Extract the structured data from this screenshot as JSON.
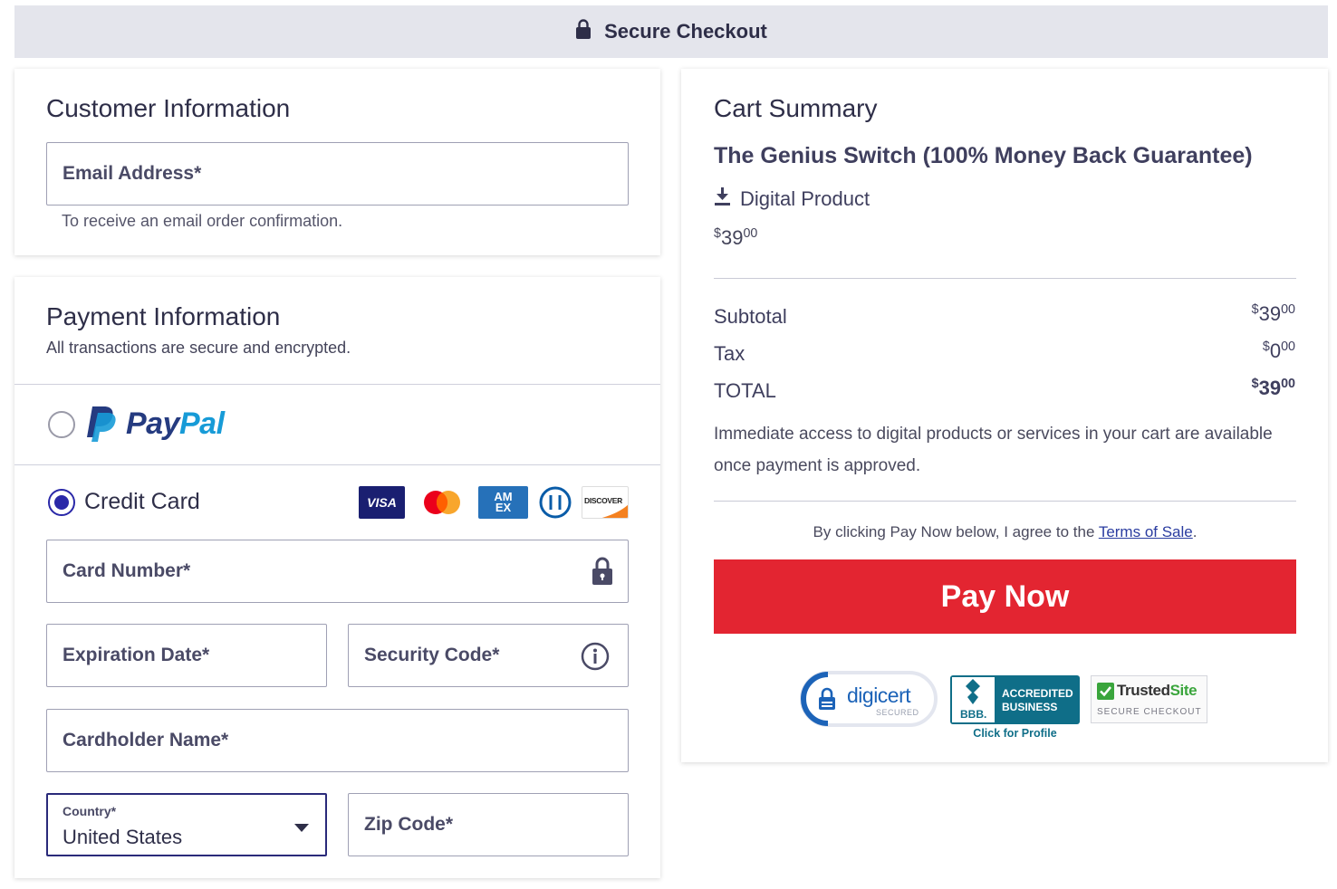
{
  "header": {
    "title": "Secure Checkout"
  },
  "customer": {
    "title": "Customer Information",
    "email_placeholder": "Email Address*",
    "email_helper": "To receive an email order confirmation."
  },
  "payment": {
    "title": "Payment Information",
    "subtitle": "All transactions are secure and encrypted.",
    "paypal_label_pay": "Pay",
    "paypal_label_pal": "Pal",
    "credit_card_label": "Credit Card",
    "card_logos": {
      "visa": "VISA",
      "amex": "AM EX",
      "discover": "DISCOVER"
    },
    "card_number_placeholder": "Card Number*",
    "expiration_placeholder": "Expiration Date*",
    "security_code_placeholder": "Security Code*",
    "cardholder_placeholder": "Cardholder Name*",
    "country_label": "Country*",
    "country_value": "United States",
    "zip_placeholder": "Zip Code*"
  },
  "cart": {
    "title": "Cart Summary",
    "product_name": "The Genius Switch (100% Money Back Guarantee)",
    "product_type": "Digital Product",
    "product_price": {
      "currency": "$",
      "whole": "39",
      "cents": "00"
    },
    "subtotal_label": "Subtotal",
    "subtotal": {
      "currency": "$",
      "whole": "39",
      "cents": "00"
    },
    "tax_label": "Tax",
    "tax": {
      "currency": "$",
      "whole": "0",
      "cents": "00"
    },
    "total_label": "TOTAL",
    "total": {
      "currency": "$",
      "whole": "39",
      "cents": "00"
    },
    "access_note": "Immediate access to digital products or services in your cart are available once payment is approved.",
    "agree_prefix": "By clicking Pay Now below, I agree to the ",
    "terms_link": "Terms of Sale",
    "agree_suffix": ".",
    "pay_button": "Pay Now"
  },
  "badges": {
    "digicert_name": "digicert",
    "digicert_sub": "SECURED",
    "bbb_line1": "ACCREDITED",
    "bbb_line2": "BUSINESS",
    "bbb_abbr": "BBB.",
    "bbb_link": "Click for Profile",
    "trusted_name_a": "Trusted",
    "trusted_name_b": "Site",
    "trusted_sub": "SECURE CHECKOUT"
  },
  "colors": {
    "accent": "#2a28a8",
    "pay_button": "#e32531",
    "paypal_dark": "#253b80",
    "paypal_light": "#179bd7"
  }
}
